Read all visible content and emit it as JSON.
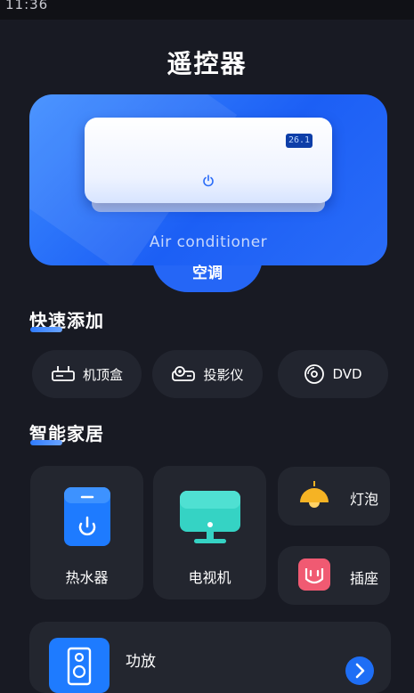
{
  "status_bar": {
    "time": "11:36"
  },
  "page": {
    "title": "遥控器"
  },
  "hero": {
    "name_en": "Air conditioner",
    "name_cn": "空调",
    "display_temp": "26.1"
  },
  "quick_add": {
    "heading": "快速添加",
    "items": [
      {
        "label": "机顶盒",
        "icon": "set-top-box-icon"
      },
      {
        "label": "投影仪",
        "icon": "projector-icon"
      },
      {
        "label": "DVD",
        "icon": "disc-icon"
      }
    ]
  },
  "smart_home": {
    "heading": "智能家居",
    "cards": [
      {
        "label": "热水器",
        "icon": "water-heater-icon"
      },
      {
        "label": "电视机",
        "icon": "tv-icon"
      },
      {
        "label": "灯泡",
        "icon": "lamp-icon"
      },
      {
        "label": "插座",
        "icon": "socket-icon"
      }
    ],
    "row_item": {
      "label": "功放",
      "icon": "speaker-icon"
    }
  },
  "colors": {
    "accent": "#2566f6",
    "background": "#181a23",
    "card": "#23262f",
    "tv": "#35d3c4",
    "heater": "#1e7bff",
    "lamp": "#f5b324",
    "socket": "#f05a72"
  }
}
